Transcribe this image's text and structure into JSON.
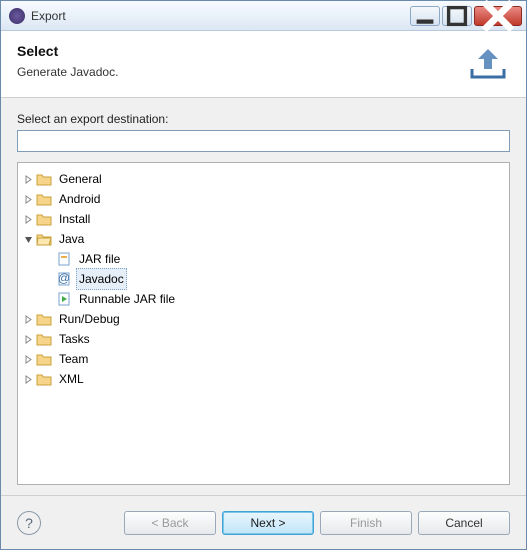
{
  "window": {
    "title": "Export"
  },
  "header": {
    "title": "Select",
    "subtitle": "Generate Javadoc."
  },
  "content": {
    "destination_label": "Select an export destination:",
    "search_value": ""
  },
  "tree": {
    "general": "General",
    "android": "Android",
    "install": "Install",
    "java": "Java",
    "java_children": {
      "jar": "JAR file",
      "javadoc": "Javadoc",
      "runnable": "Runnable JAR file"
    },
    "rundebug": "Run/Debug",
    "tasks": "Tasks",
    "team": "Team",
    "xml": "XML"
  },
  "footer": {
    "back": "< Back",
    "next": "Next >",
    "finish": "Finish",
    "cancel": "Cancel"
  }
}
